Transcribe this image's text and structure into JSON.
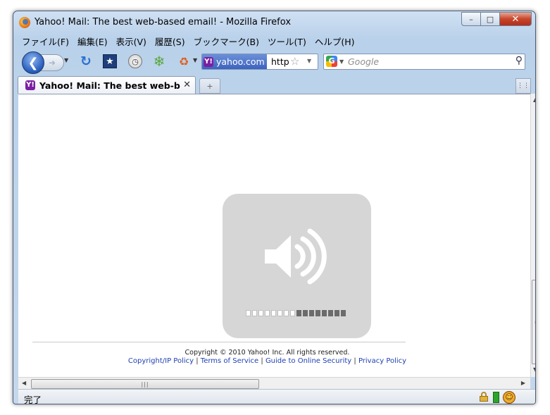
{
  "window": {
    "title": "Yahoo! Mail: The best web-based email! - Mozilla Firefox",
    "minimize": "–",
    "maximize": "□",
    "close": "✕"
  },
  "menubar": {
    "items": [
      "ファイル(F)",
      "編集(E)",
      "表示(V)",
      "履歴(S)",
      "ブックマーク(B)",
      "ツール(T)",
      "ヘルプ(H)"
    ]
  },
  "navbar": {
    "back_icon": "back-arrow-icon",
    "forward_icon": "forward-arrow-icon",
    "site_identity": "yahoo.com",
    "url_value": "http",
    "search_engine": "G",
    "search_placeholder": "Google"
  },
  "tabs": [
    {
      "label": "Yahoo! Mail: The best web-b...",
      "favicon": "Y!"
    }
  ],
  "page": {
    "copyright": "Copyright © 2010 Yahoo! Inc. All rights reserved.",
    "links": [
      "Copyright/IP Policy",
      "Terms of Service",
      "Guide to Online Security",
      "Privacy Policy"
    ],
    "separator": " | "
  },
  "volume_osd": {
    "icon": "speaker-volume-icon",
    "total_segments": 16,
    "filled_segments": 8,
    "level": 0.5,
    "background": "#d6d6d6",
    "filled_color": "#6b6b6b"
  },
  "status": {
    "text": "完了"
  },
  "colors": {
    "frame": "#b9d1ea",
    "link": "#1d3fb3",
    "site_identity": "#3d63c0",
    "close_button": "#c7452a"
  }
}
